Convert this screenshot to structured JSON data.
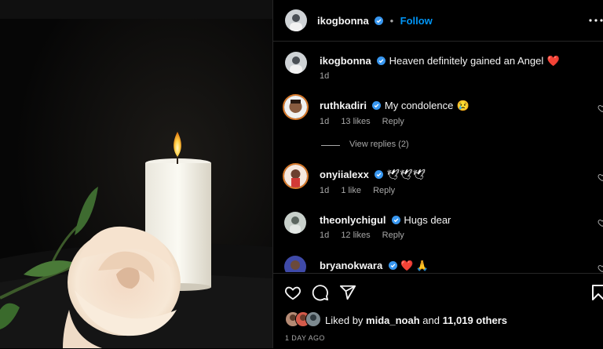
{
  "post": {
    "author": "ikogbonna",
    "follow_label": "Follow",
    "separator": "•"
  },
  "caption": {
    "username": "ikogbonna",
    "text": "Heaven definitely gained an Angel",
    "emoji": "❤️",
    "time": "1d"
  },
  "comments": [
    {
      "username": "ruthkadiri",
      "text": "My condolence",
      "emoji": "😢",
      "time": "1d",
      "likes": "13 likes",
      "reply": "Reply"
    },
    {
      "username": "onyiialexx",
      "text": "🕊🕊🕊",
      "time": "1d",
      "likes": "1 like",
      "reply": "Reply"
    },
    {
      "username": "theonlychigul",
      "text": "Hugs dear",
      "time": "1d",
      "likes": "12 likes",
      "reply": "Reply"
    },
    {
      "username": "bryanokwara",
      "text": "❤️ 🙏"
    }
  ],
  "view_replies": "View replies (2)",
  "likes": {
    "prefix": "Liked by",
    "user": "mida_noah",
    "middle": "and",
    "count": "11,019 others"
  },
  "timestamp": "1 DAY AGO",
  "icons": {
    "heart": "heart-icon",
    "comment": "comment-icon",
    "share": "share-icon",
    "save": "bookmark-icon",
    "more": "more-options-icon",
    "verified": "verified-badge-icon"
  },
  "colors": {
    "accent": "#0095f6",
    "verified": "#3897f0",
    "background": "#000000",
    "muted": "#a8a8a8"
  }
}
